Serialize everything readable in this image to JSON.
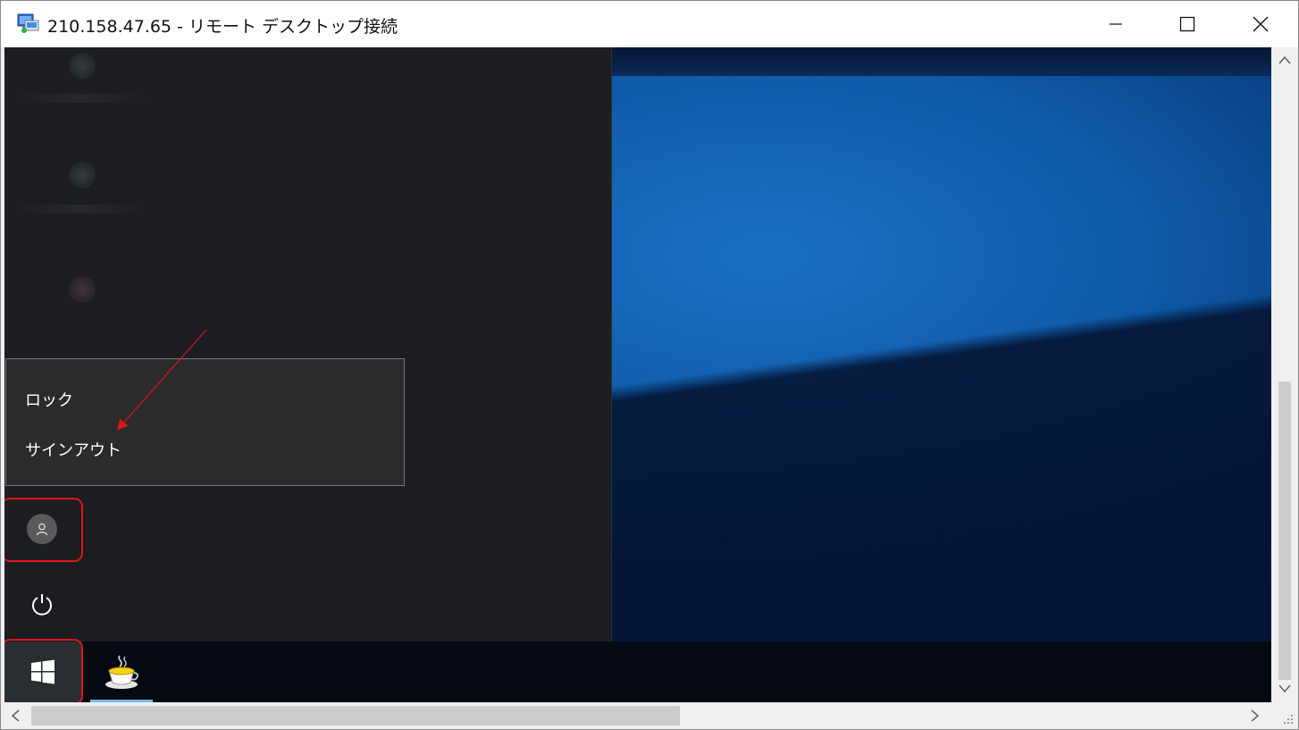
{
  "window": {
    "title": "210.158.47.65 - リモート デスクトップ接続",
    "buttons": [
      "minimize",
      "maximize",
      "close"
    ]
  },
  "start_menu": {
    "popup_items": [
      {
        "label": "ロック"
      },
      {
        "label": "サインアウト"
      }
    ],
    "user_icon": "user-avatar-icon",
    "power_icon": "power-icon"
  },
  "taskbar": {
    "start_icon": "windows-logo-icon",
    "pinned_app_icon": "java-coffee-cup-icon"
  },
  "annotations": {
    "highlight_color": "#e0141e"
  }
}
